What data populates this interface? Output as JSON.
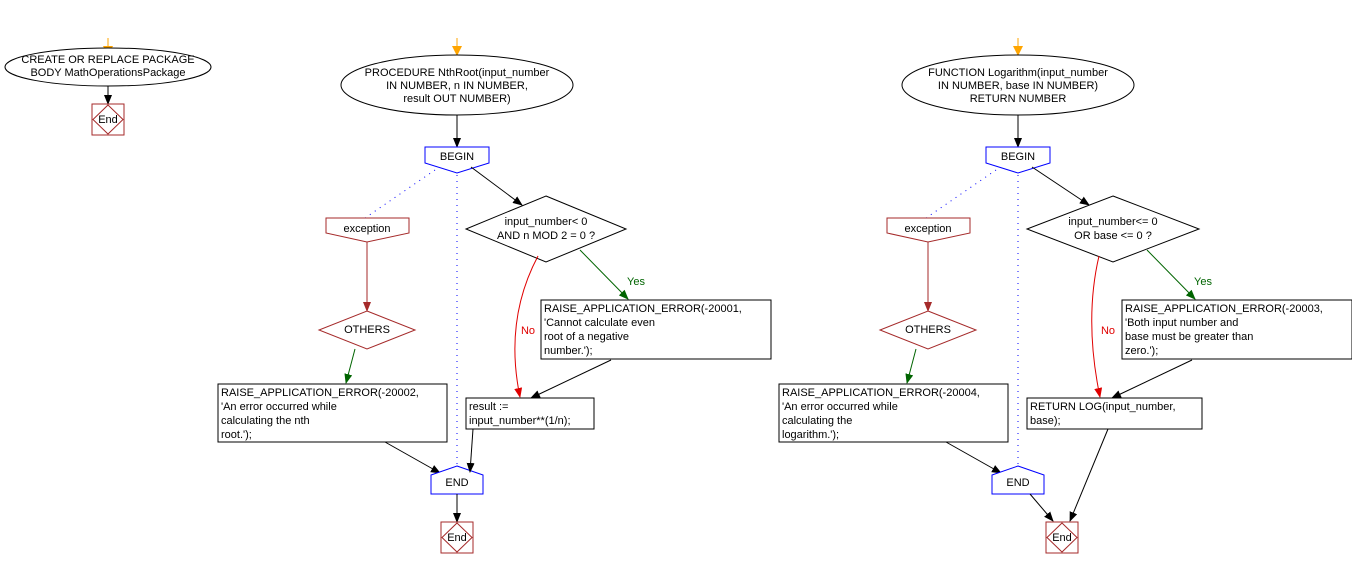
{
  "colors": {
    "start_arrow": "#ffa500",
    "begin_end": "#0000ff",
    "exception": "#a52a2a",
    "yes": "#006400",
    "no": "#e00000",
    "line": "#000000"
  },
  "package": {
    "start": [
      "CREATE OR REPLACE PACKAGE",
      "BODY MathOperationsPackage"
    ],
    "end": "End"
  },
  "procedures": [
    {
      "header": [
        "PROCEDURE NthRoot(input_number",
        "IN NUMBER, n IN NUMBER,",
        "result OUT NUMBER)"
      ],
      "begin": "BEGIN",
      "exception": "exception",
      "others": "OTHERS",
      "others_action": [
        "RAISE_APPLICATION_ERROR(-20002,",
        "'An error occurred while",
        "calculating the nth",
        "root.');"
      ],
      "condition": [
        "input_number< 0",
        "AND n MOD 2 = 0 ?"
      ],
      "yes_label": "Yes",
      "no_label": "No",
      "yes_action": [
        "RAISE_APPLICATION_ERROR(-20001,",
        "'Cannot calculate even",
        "root of a negative",
        "number.');"
      ],
      "no_action": [
        "result :=",
        "input_number**(1/n);"
      ],
      "end_block": "END",
      "end": "End"
    },
    {
      "header": [
        "FUNCTION Logarithm(input_number",
        "IN NUMBER, base IN NUMBER)",
        "RETURN NUMBER"
      ],
      "begin": "BEGIN",
      "exception": "exception",
      "others": "OTHERS",
      "others_action": [
        "RAISE_APPLICATION_ERROR(-20004,",
        "'An error occurred while",
        "calculating the",
        "logarithm.');"
      ],
      "condition": [
        "input_number<= 0",
        "OR base <= 0 ?"
      ],
      "yes_label": "Yes",
      "no_label": "No",
      "yes_action": [
        "RAISE_APPLICATION_ERROR(-20003,",
        "'Both input number and",
        "base must be greater than",
        "zero.');"
      ],
      "no_action": [
        "RETURN LOG(input_number,",
        "base);"
      ],
      "end_block": "END",
      "end": "End"
    }
  ]
}
